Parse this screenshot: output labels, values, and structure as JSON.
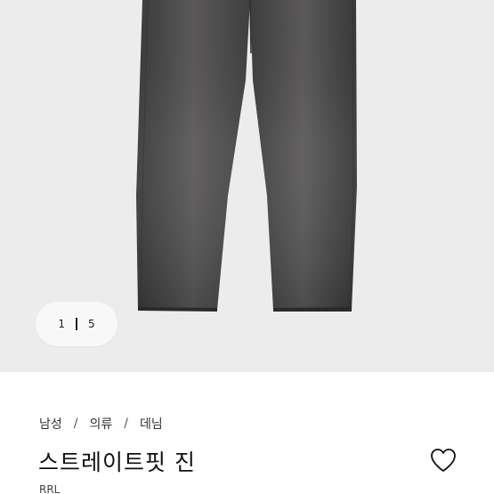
{
  "gallery": {
    "current_index": "1",
    "total_count": "5"
  },
  "breadcrumb": {
    "items": [
      "남성",
      "의류",
      "데님"
    ],
    "separator": "/"
  },
  "product": {
    "title": "스트레이트핏 진",
    "brand": "RRL",
    "wishlist_icon": "heart-outline-icon"
  },
  "colors": {
    "gallery_bg": "#ececec",
    "denim": "#4a4a4a",
    "text": "#111111"
  }
}
